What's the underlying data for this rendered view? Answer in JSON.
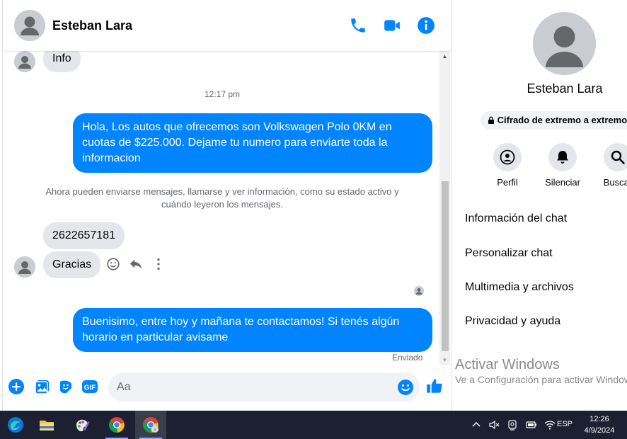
{
  "header": {
    "contact_name": "Esteban Lara",
    "icons": [
      "phone-icon",
      "video-icon",
      "info-icon"
    ],
    "accent_color": "#0084ff"
  },
  "messages": {
    "first_incoming": "Info",
    "timestamp": "12:17 pm",
    "outgoing_1": "Hola, Los autos que ofrecemos son Volkswagen Polo 0KM en cuotas de $225.000. Dejame tu numero para enviarte toda la informacion",
    "system_notice": "Ahora pueden enviarse mensajes, llamarse y ver información, como su estado activo y cuándo leyeron los mensajes.",
    "incoming_phone": "2622657181",
    "incoming_thanks": "Gracias",
    "outgoing_2": "Buenisimo, entre hoy y mañana te contactamos! Si tenés algún horario en particular avisame",
    "sent_status": "Enviado"
  },
  "composer": {
    "placeholder": "Aa"
  },
  "profile": {
    "name": "Esteban Lara",
    "encryption_label": "Cifrado de extremo a extremo",
    "actions": [
      {
        "label": "Perfil",
        "icon": "profile-icon"
      },
      {
        "label": "Silenciar",
        "icon": "bell-icon"
      },
      {
        "label": "Buscar",
        "icon": "search-icon"
      }
    ],
    "menu": [
      "Información del chat",
      "Personalizar chat",
      "Multimedia y archivos",
      "Privacidad y ayuda"
    ]
  },
  "watermark": {
    "title": "Activar Windows",
    "subtitle": "Ve a Configuración para activar Windows."
  },
  "taskbar": {
    "language": "ESP",
    "time": "12:26",
    "date": "4/9/2024"
  }
}
